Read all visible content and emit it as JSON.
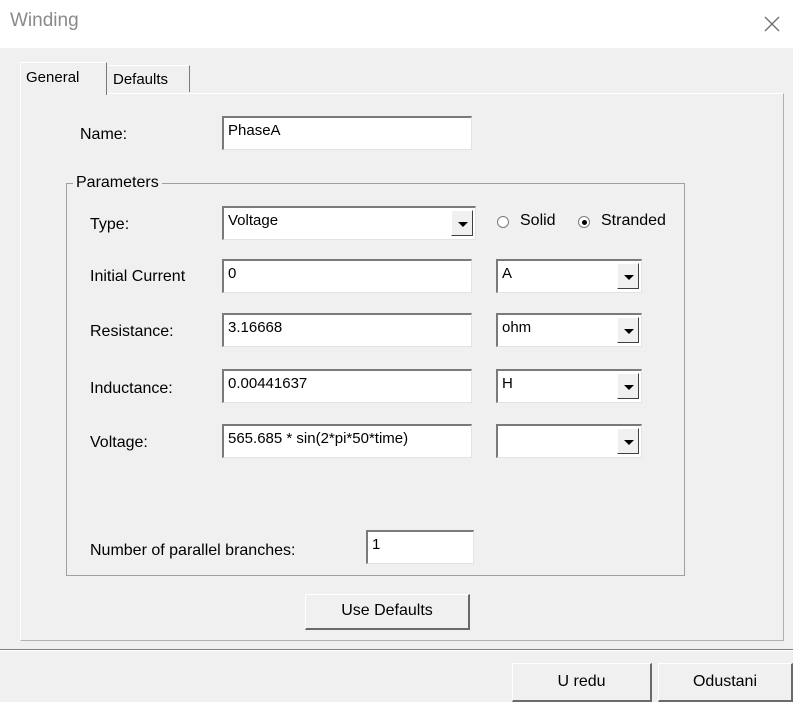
{
  "window": {
    "title": "Winding",
    "close_icon": "close-icon"
  },
  "tabs": [
    {
      "label": "General",
      "selected": true
    },
    {
      "label": "Defaults",
      "selected": false
    }
  ],
  "name_field": {
    "label": "Name:",
    "value": "PhaseA"
  },
  "parameters": {
    "group_label": "Parameters",
    "type": {
      "label": "Type:",
      "value": "Voltage",
      "radio_solid": {
        "label": "Solid",
        "checked": false
      },
      "radio_stranded": {
        "label": "Stranded",
        "checked": true
      }
    },
    "initial_current": {
      "label": "Initial Current",
      "value": "0",
      "unit": "A"
    },
    "resistance": {
      "label": "Resistance:",
      "value": "3.16668",
      "unit": "ohm"
    },
    "inductance": {
      "label": "Inductance:",
      "value": "0.00441637",
      "unit": "H"
    },
    "voltage": {
      "label": "Voltage:",
      "value": "565.685 * sin(2*pi*50*time)",
      "unit": ""
    },
    "parallel_branches": {
      "label": "Number of parallel branches:",
      "value": "1"
    }
  },
  "buttons": {
    "use_defaults": "Use Defaults",
    "ok": "U redu",
    "cancel": "Odustani"
  }
}
